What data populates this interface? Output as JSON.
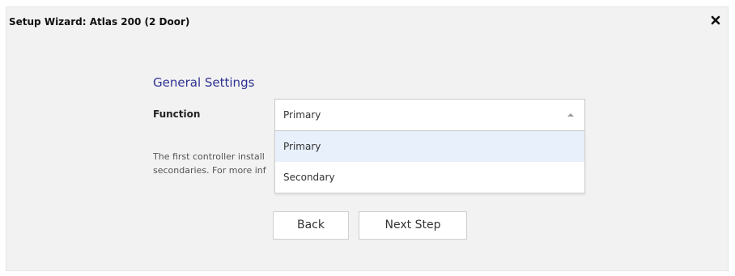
{
  "dialog": {
    "title": "Setup Wizard: Atlas 200 (2 Door)",
    "close_icon": "close-icon"
  },
  "section": {
    "title": "General Settings"
  },
  "function_field": {
    "label": "Function",
    "selected_value": "Primary",
    "dropdown_open": true,
    "options": [
      "Primary",
      "Secondary"
    ],
    "arrow_icon": "chevron-up-icon"
  },
  "help_text": {
    "line1": "The first controller install",
    "line2": "secondaries. For more inf"
  },
  "buttons": {
    "back_label": "Back",
    "next_label": "Next Step"
  },
  "colors": {
    "dialog_background": "#f2f2f2",
    "section_title": "#2e3192",
    "selected_option_background": "#e8f0fb"
  }
}
